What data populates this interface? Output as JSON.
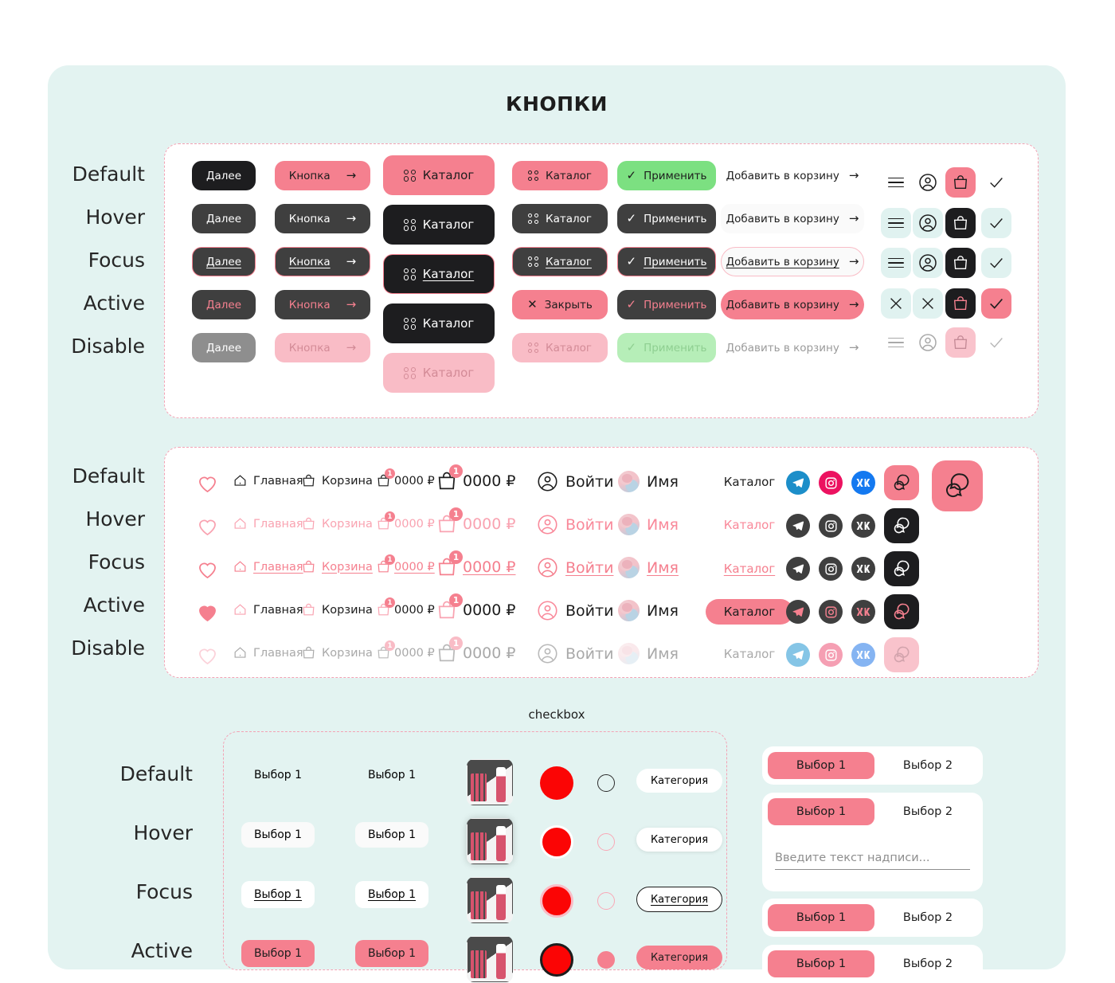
{
  "page": {
    "title": "КНОПКИ",
    "checkbox_section_title": "checkbox"
  },
  "states": [
    "Default",
    "Hover",
    "Focus",
    "Active",
    "Disable"
  ],
  "buttons_section": {
    "col_next": {
      "label": "Далее"
    },
    "col_knopka": {
      "label": "Кнопка",
      "icon": "arrow-right-icon",
      "arrow": "→"
    },
    "col_catalog_big": {
      "label": "Каталог",
      "icon": "grid-icon"
    },
    "col_catalog_small": {
      "label": "Каталог",
      "active_label": "Закрыть",
      "icon": "grid-icon",
      "close_icon": "✕"
    },
    "col_apply": {
      "label": "Применить",
      "icon": "check-icon",
      "check": "✓"
    },
    "col_addcart": {
      "label": "Добавить в корзину",
      "arrow": "→"
    },
    "icons": {
      "burger": "menu-icon",
      "user": "user-icon",
      "bag": "bag-icon",
      "check": "check-icon",
      "close": "close-icon",
      "check_glyph": "✓",
      "close_glyph": "✕"
    }
  },
  "links_section": {
    "heart": {
      "name": "heart-icon"
    },
    "home": {
      "label": "Главная",
      "icon": "home-icon"
    },
    "cart": {
      "label": "Корзина",
      "icon": "bag-icon"
    },
    "price_small": {
      "label": "0000 ₽",
      "badge": "1",
      "icon": "bag-icon"
    },
    "price_big": {
      "label": "0000 ₽",
      "badge": "1",
      "icon": "bag-icon"
    },
    "login": {
      "label": "Войти",
      "icon": "user-icon"
    },
    "name": {
      "label": "Имя",
      "icon": "avatar"
    },
    "catalog": {
      "label": "Каталог"
    },
    "social": {
      "telegram": "telegram-icon",
      "instagram": "instagram-icon",
      "vk": "vk-icon"
    },
    "chat": {
      "name": "chat-bubbles-icon"
    }
  },
  "checkbox_section": {
    "choice1": "Выбор 1",
    "category": "Категория",
    "product_thumb": "product-image",
    "color_swatch": "color-swatch-red",
    "radio": "radio-button"
  },
  "toggles": {
    "option1": "Выбор 1",
    "option2": "Выбор 2",
    "input_placeholder": "Введите текст надписи..."
  },
  "colors": {
    "background": "#e3f3f1",
    "accent_pink": "#f5808f",
    "accent_pink_light": "#f9bcc6",
    "dark": "#1d1d1f",
    "grey": "#3f3f3f",
    "green": "#7ce081",
    "mint": "#e0f2f0",
    "red": "#fb0505"
  }
}
